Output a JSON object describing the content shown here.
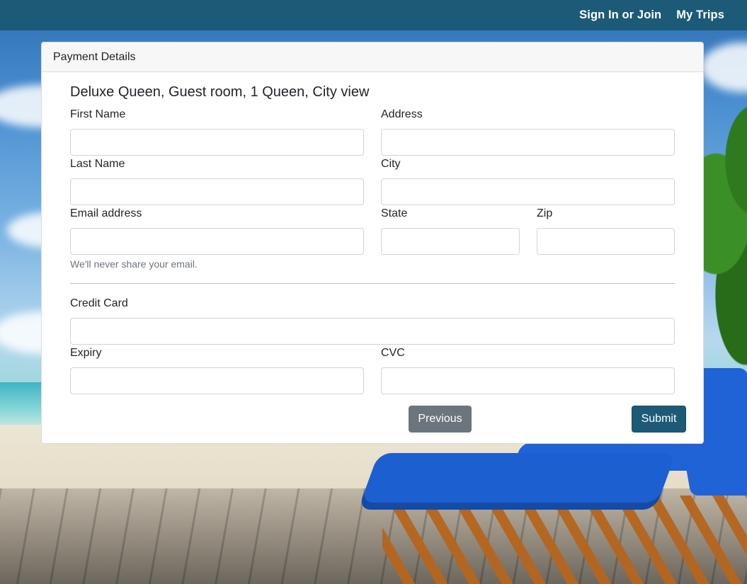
{
  "nav": {
    "sign_in": "Sign In or Join",
    "my_trips": "My Trips"
  },
  "card": {
    "header": "Payment Details",
    "room_title": "Deluxe Queen, Guest room, 1 Queen, City view"
  },
  "form": {
    "first_name": {
      "label": "First Name",
      "value": ""
    },
    "last_name": {
      "label": "Last Name",
      "value": ""
    },
    "email": {
      "label": "Email address",
      "value": "",
      "help": "We'll never share your email."
    },
    "address": {
      "label": "Address",
      "value": ""
    },
    "city": {
      "label": "City",
      "value": ""
    },
    "state": {
      "label": "State",
      "value": ""
    },
    "zip": {
      "label": "Zip",
      "value": ""
    },
    "credit_card": {
      "label": "Credit Card",
      "value": ""
    },
    "expiry": {
      "label": "Expiry",
      "value": ""
    },
    "cvc": {
      "label": "CVC",
      "value": ""
    }
  },
  "buttons": {
    "previous": "Previous",
    "submit": "Submit"
  },
  "colors": {
    "navbar": "#1d5a77",
    "submit": "#1d5a77",
    "previous": "#6c757d"
  }
}
